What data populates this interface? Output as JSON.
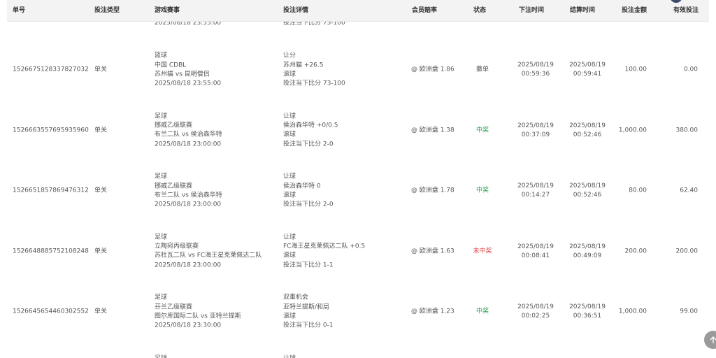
{
  "headers": {
    "order_no": "单号",
    "bet_type": "投注类型",
    "event": "游戏赛事",
    "details": "投注详情",
    "odds": "会员赔率",
    "status": "状态",
    "bet_time": "下注时间",
    "settle_time": "结算时间",
    "amount": "投注金额",
    "valid_bet": "有效投注"
  },
  "partial_top": {
    "event_date": "2025/08/18 23:55:00",
    "detail_last": "投注当下比分 75-100"
  },
  "rows": [
    {
      "order_no": "1526675128337827032",
      "bet_type": "单关",
      "event": [
        "篮球",
        "中国 CDBL",
        "苏州猫 vs 昆明僧侣",
        "2025/08/18 23:55:00"
      ],
      "details": [
        "让分",
        "苏州猫 +26.5",
        "滚球",
        "投注当下比分 73-100"
      ],
      "odds": "@ 欧洲盘 1.86",
      "status": "撤单",
      "status_kind": "cancel",
      "bet_date": "2025/08/19",
      "bet_clock": "00:59:36",
      "settle_date": "2025/08/19",
      "settle_clock": "00:59:41",
      "amount": "100.00",
      "valid_bet": "0.00"
    },
    {
      "order_no": "1526663557695935960",
      "bet_type": "单关",
      "event": [
        "足球",
        "挪威乙级联赛",
        "布兰二队 vs 侯治森华特",
        "2025/08/18 23:00:00"
      ],
      "details": [
        "让球",
        "侯治森华特 +0/0.5",
        "滚球",
        "投注当下比分 2-0"
      ],
      "odds": "@ 欧洲盘 1.38",
      "status": "中奖",
      "status_kind": "win",
      "bet_date": "2025/08/19",
      "bet_clock": "00:37:09",
      "settle_date": "2025/08/19",
      "settle_clock": "00:52:46",
      "amount": "1,000.00",
      "valid_bet": "380.00"
    },
    {
      "order_no": "1526651857869476312",
      "bet_type": "单关",
      "event": [
        "足球",
        "挪威乙级联赛",
        "布兰二队 vs 侯治森华特",
        "2025/08/18 23:00:00"
      ],
      "details": [
        "让球",
        "侯治森华特 0",
        "滚球",
        "投注当下比分 2-0"
      ],
      "odds": "@ 欧洲盘 1.78",
      "status": "中奖",
      "status_kind": "win",
      "bet_date": "2025/08/19",
      "bet_clock": "00:14:27",
      "settle_date": "2025/08/19",
      "settle_clock": "00:52:46",
      "amount": "80.00",
      "valid_bet": "62.40"
    },
    {
      "order_no": "1526648885752108248",
      "bet_type": "单关",
      "event": [
        "足球",
        "立陶宛丙级联赛",
        "苏杜瓦二队 vs FC海王星克莱佩达二队",
        "2025/08/18 23:00:00"
      ],
      "details": [
        "让球",
        "FC海王星克莱佩达二队 +0.5",
        "滚球",
        "投注当下比分 1-1"
      ],
      "odds": "@ 欧洲盘 1.63",
      "status": "未中奖",
      "status_kind": "lose",
      "bet_date": "2025/08/19",
      "bet_clock": "00:08:41",
      "settle_date": "2025/08/19",
      "settle_clock": "00:49:09",
      "amount": "200.00",
      "valid_bet": "200.00"
    },
    {
      "order_no": "1526645654460302552",
      "bet_type": "单关",
      "event": [
        "足球",
        "芬兰乙级联赛",
        "图尔库国际二队 vs 亚特兰提斯",
        "2025/08/18 23:30:00"
      ],
      "details": [
        "双重机会",
        "亚特兰提斯/和局",
        "滚球",
        "投注当下比分 0-1"
      ],
      "odds": "@ 欧洲盘 1.23",
      "status": "中奖",
      "status_kind": "win",
      "bet_date": "2025/08/19",
      "bet_clock": "00:02:25",
      "settle_date": "2025/08/19",
      "settle_clock": "00:36:51",
      "amount": "1,000.00",
      "valid_bet": "99.00"
    }
  ],
  "partial_bottom": {
    "event_first": "足球",
    "detail_first": "让球"
  },
  "colors": {
    "win": "#2e9e4f",
    "lose": "#e04545",
    "header_bg": "#f3f3f3"
  },
  "icons": {
    "scroll_top": "arrow-up-icon"
  }
}
